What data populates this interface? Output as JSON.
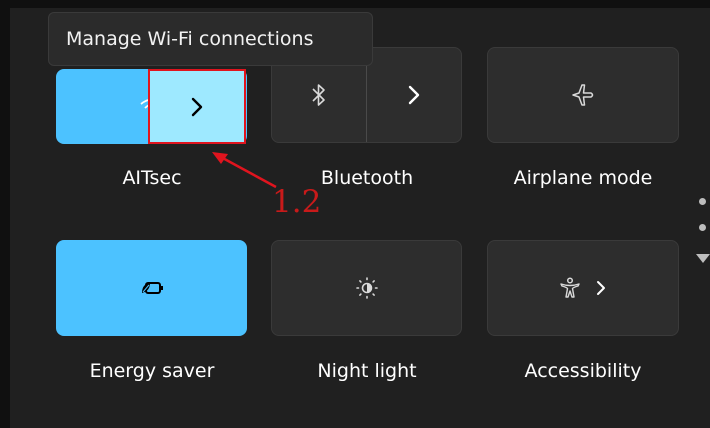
{
  "tooltip": {
    "text": "Manage Wi-Fi connections"
  },
  "tiles": {
    "wifi": {
      "label": "AITsec",
      "icon": "wifi-icon",
      "state": "on"
    },
    "bluetooth": {
      "label": "Bluetooth",
      "icon": "bluetooth-icon",
      "state": "off"
    },
    "airplane": {
      "label": "Airplane mode",
      "icon": "airplane-icon",
      "state": "off"
    },
    "energy": {
      "label": "Energy saver",
      "icon": "energy-saver-icon",
      "state": "on"
    },
    "night": {
      "label": "Night light",
      "icon": "night-light-icon",
      "state": "off"
    },
    "accessibility": {
      "label": "Accessibility",
      "icon": "accessibility-icon",
      "state": "off"
    }
  },
  "annotation": {
    "text": "1.2",
    "color": "#c81a1a"
  },
  "colors": {
    "accent": "#4cc2ff",
    "highlight": "#9ee9ff",
    "panel": "#202020",
    "tile_off": "#2d2d2d"
  }
}
